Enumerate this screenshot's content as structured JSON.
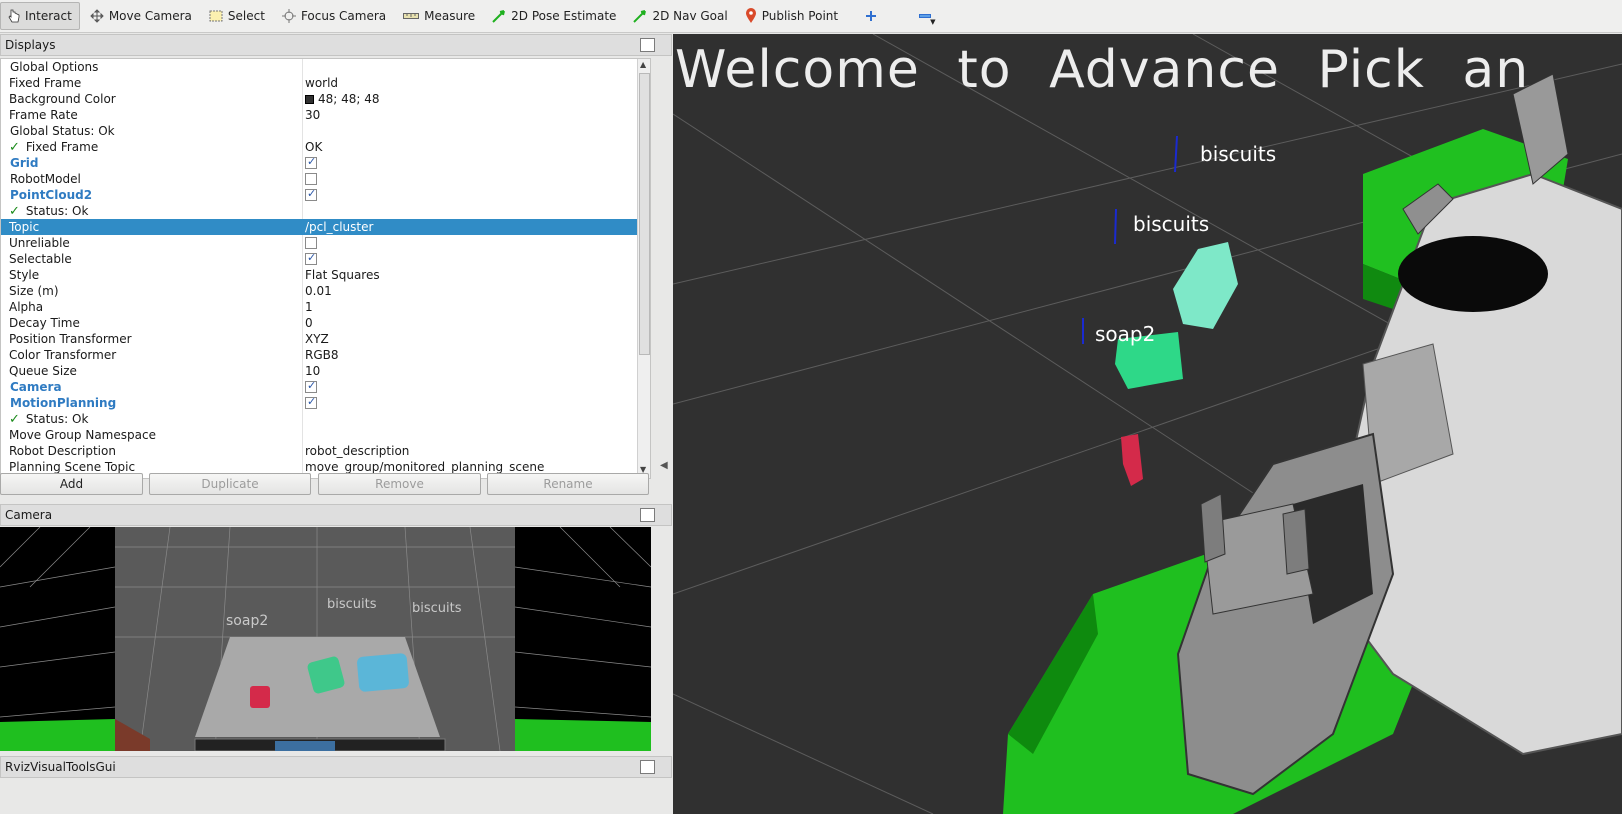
{
  "toolbar": {
    "tools": [
      {
        "label": "Interact",
        "icon": "hand-pointer-icon",
        "active": true
      },
      {
        "label": "Move Camera",
        "icon": "move-arrows-icon"
      },
      {
        "label": "Select",
        "icon": "select-box-icon"
      },
      {
        "label": "Focus Camera",
        "icon": "crosshair-icon"
      },
      {
        "label": "Measure",
        "icon": "ruler-icon"
      },
      {
        "label": "2D Pose Estimate",
        "icon": "green-arrow-icon"
      },
      {
        "label": "2D Nav Goal",
        "icon": "green-arrow-icon"
      },
      {
        "label": "Publish Point",
        "icon": "map-pin-icon"
      }
    ],
    "add_icon": "plus-icon",
    "remove_icon": "minus-icon"
  },
  "displays": {
    "title": "Displays",
    "rows": [
      {
        "name": "Global Options",
        "value": "",
        "kind": "header"
      },
      {
        "name": "Fixed Frame",
        "value": "world"
      },
      {
        "name": "Background Color",
        "value": "48; 48; 48",
        "swatch": "#303030"
      },
      {
        "name": "Frame Rate",
        "value": "30"
      },
      {
        "name": "Global Status: Ok",
        "value": "",
        "kind": "header"
      },
      {
        "name": "Fixed Frame",
        "value": "OK",
        "check": true
      },
      {
        "name": "Grid",
        "value": "",
        "kind": "display",
        "checkbox": true
      },
      {
        "name": "RobotModel",
        "value": "",
        "kind": "plain",
        "checkbox": false
      },
      {
        "name": "PointCloud2",
        "value": "",
        "kind": "display",
        "checkbox": true
      },
      {
        "name": "Status: Ok",
        "value": "",
        "check": true
      },
      {
        "name": "Topic",
        "value": "/pcl_cluster",
        "selected": true
      },
      {
        "name": "Unreliable",
        "value": "",
        "checkbox": false
      },
      {
        "name": "Selectable",
        "value": "",
        "checkbox": true
      },
      {
        "name": "Style",
        "value": "Flat Squares"
      },
      {
        "name": "Size (m)",
        "value": "0.01"
      },
      {
        "name": "Alpha",
        "value": "1"
      },
      {
        "name": "Decay Time",
        "value": "0"
      },
      {
        "name": "Position Transformer",
        "value": "XYZ"
      },
      {
        "name": "Color Transformer",
        "value": "RGB8"
      },
      {
        "name": "Queue Size",
        "value": "10"
      },
      {
        "name": "Camera",
        "value": "",
        "kind": "display",
        "checkbox": true
      },
      {
        "name": "MotionPlanning",
        "value": "",
        "kind": "display",
        "checkbox": true
      },
      {
        "name": "Status: Ok",
        "value": "",
        "check": true
      },
      {
        "name": "Move Group Namespace",
        "value": ""
      },
      {
        "name": "Robot Description",
        "value": "robot_description"
      },
      {
        "name": "Planning Scene Topic",
        "value": "move_group/monitored_planning_scene"
      }
    ],
    "buttons": {
      "add": "Add",
      "duplicate": "Duplicate",
      "remove": "Remove",
      "rename": "Rename"
    }
  },
  "camera_panel": {
    "title": "Camera",
    "labels": {
      "soap": "soap2",
      "biscuits1": "biscuits",
      "biscuits2": "biscuits"
    }
  },
  "rviz_gui_panel": {
    "title": "RvizVisualToolsGui"
  },
  "view3d": {
    "banner": "Welcome to Advance Pick an",
    "labels": {
      "biscuits_top": "biscuits",
      "biscuits_mid": "biscuits",
      "soap": "soap2"
    },
    "background_color": "#303030",
    "colors": {
      "biscuits_cloud": "#7ee8c8",
      "soap_cloud": "#2ed888",
      "red_cloud": "#d42a4a",
      "robot_base": "#1fc21f"
    }
  }
}
